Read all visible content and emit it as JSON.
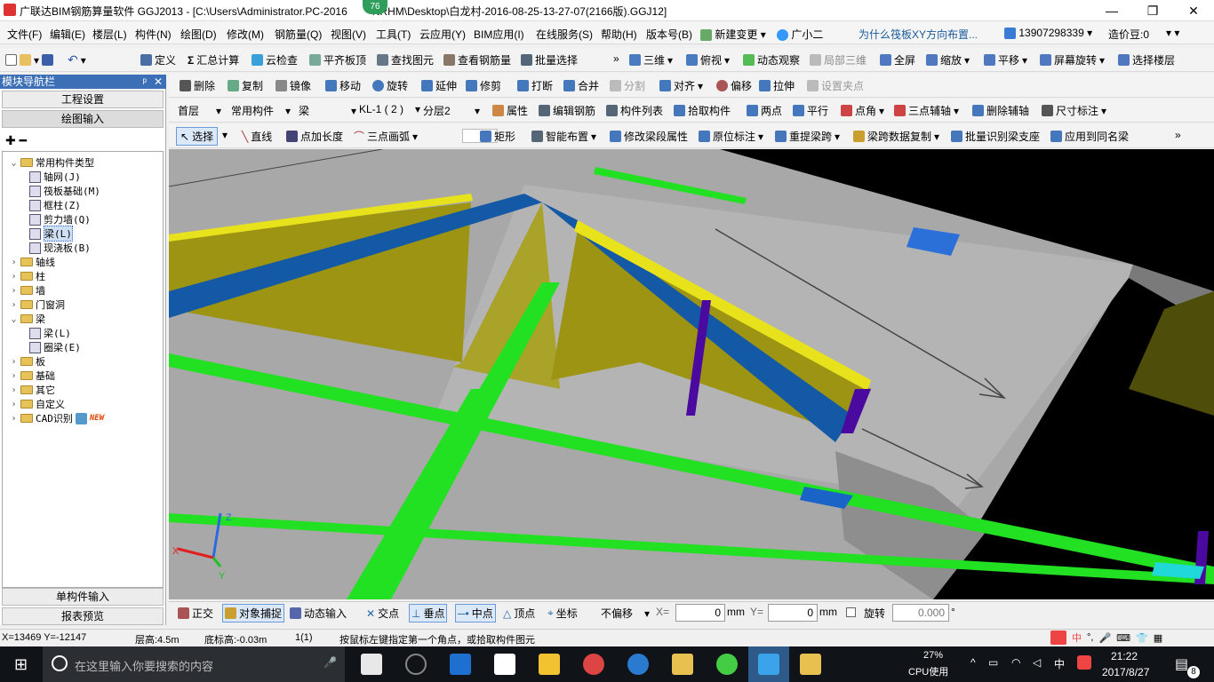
{
  "window": {
    "title": "广联达BIM钢筋算量软件 GGJ2013 - [C:\\Users\\Administrator.PC-2016",
    "title_tail": "NRHM\\Desktop\\白龙村-2016-08-25-13-27-07(2166版).GGJ12]",
    "badge": "76",
    "min": "—",
    "max": "❐",
    "close": "✕"
  },
  "menu": [
    "文件(F)",
    "编辑(E)",
    "楼层(L)",
    "构件(N)",
    "绘图(D)",
    "修改(M)",
    "钢筋量(Q)",
    "视图(V)",
    "工具(T)",
    "云应用(Y)",
    "BIM应用(I)",
    "在线服务(S)",
    "帮助(H)",
    "版本号(B)",
    "新建变更",
    "广小二"
  ],
  "menu_right": {
    "question": "为什么筏板XY方向布置...",
    "phone": "13907298339",
    "beans": "造价豆:0"
  },
  "toolbar1": [
    "定义",
    "汇总计算",
    "云检查",
    "平齐板顶",
    "查找图元",
    "查看钢筋量",
    "批量选择",
    "三维",
    "俯视",
    "动态观察",
    "局部三维",
    "全屏",
    "缩放",
    "平移",
    "屏幕旋转",
    "选择楼层"
  ],
  "toolbar2": [
    "删除",
    "复制",
    "镜像",
    "移动",
    "旋转",
    "延伸",
    "修剪",
    "打断",
    "合并",
    "分割",
    "对齐",
    "偏移",
    "拉伸",
    "设置夹点"
  ],
  "toolbar3": {
    "floor": "首层",
    "type": "常用构件",
    "cat": "梁",
    "comp": "KL-1 ( 2 )",
    "layer": "分层2",
    "items": [
      "属性",
      "编辑钢筋",
      "构件列表",
      "拾取构件",
      "两点",
      "平行",
      "点角",
      "三点辅轴",
      "删除辅轴",
      "尺寸标注"
    ]
  },
  "toolbar4": [
    "选择",
    "直线",
    "点加长度",
    "三点画弧",
    "矩形",
    "智能布置",
    "修改梁段属性",
    "原位标注",
    "重提梁跨",
    "梁跨数据复制",
    "批量识别梁支座",
    "应用到同名梁"
  ],
  "panel": {
    "title": "模块导航栏",
    "btn1": "工程设置",
    "btn2": "绘图输入",
    "btn3": "单构件输入",
    "btn4": "报表预览",
    "tree": [
      {
        "label": "常用构件类型",
        "level": 0,
        "exp": "⌄",
        "folder": true
      },
      {
        "label": "轴网(J)",
        "level": 1
      },
      {
        "label": "筏板基础(M)",
        "level": 1
      },
      {
        "label": "框柱(Z)",
        "level": 1
      },
      {
        "label": "剪力墙(Q)",
        "level": 1
      },
      {
        "label": "梁(L)",
        "level": 1,
        "sel": true
      },
      {
        "label": "现浇板(B)",
        "level": 1
      },
      {
        "label": "轴线",
        "level": 0,
        "exp": "›",
        "folder": true
      },
      {
        "label": "柱",
        "level": 0,
        "exp": "›",
        "folder": true
      },
      {
        "label": "墙",
        "level": 0,
        "exp": "›",
        "folder": true
      },
      {
        "label": "门窗洞",
        "level": 0,
        "exp": "›",
        "folder": true
      },
      {
        "label": "梁",
        "level": 0,
        "exp": "⌄",
        "folder": true
      },
      {
        "label": "梁(L)",
        "level": 1
      },
      {
        "label": "圈梁(E)",
        "level": 1
      },
      {
        "label": "板",
        "level": 0,
        "exp": "›",
        "folder": true
      },
      {
        "label": "基础",
        "level": 0,
        "exp": "›",
        "folder": true
      },
      {
        "label": "其它",
        "level": 0,
        "exp": "›",
        "folder": true
      },
      {
        "label": "自定义",
        "level": 0,
        "exp": "›",
        "folder": true
      },
      {
        "label": "CAD识别",
        "level": 0,
        "exp": "›",
        "folder": true,
        "new": "NEW"
      }
    ]
  },
  "bottom": {
    "items": [
      "正交",
      "对象捕捉",
      "动态输入",
      "交点",
      "垂点",
      "中点",
      "顶点",
      "坐标"
    ],
    "offset": "不偏移",
    "x_label": "X=",
    "x_val": "0",
    "y_label": "Y=",
    "y_val": "0",
    "mm": "mm",
    "rotate": "旋转",
    "rot_val": "0.000",
    "deg": "°"
  },
  "status": {
    "coords": "X=13469 Y=-12147",
    "floor_h": "层高:4.5m",
    "base_h": "底标高:-0.03m",
    "count": "1(1)",
    "hint": "按鼠标左键指定第一个角点，或拾取构件图元"
  },
  "axes": {
    "z": "Z",
    "y": "Y",
    "x": "X"
  },
  "taskbar": {
    "search": "在这里输入你要搜索的内容",
    "cpu": "27%",
    "cpu_label": "CPU使用",
    "ime": "中",
    "time": "21:22",
    "date": "2017/8/27",
    "notif": "8"
  }
}
